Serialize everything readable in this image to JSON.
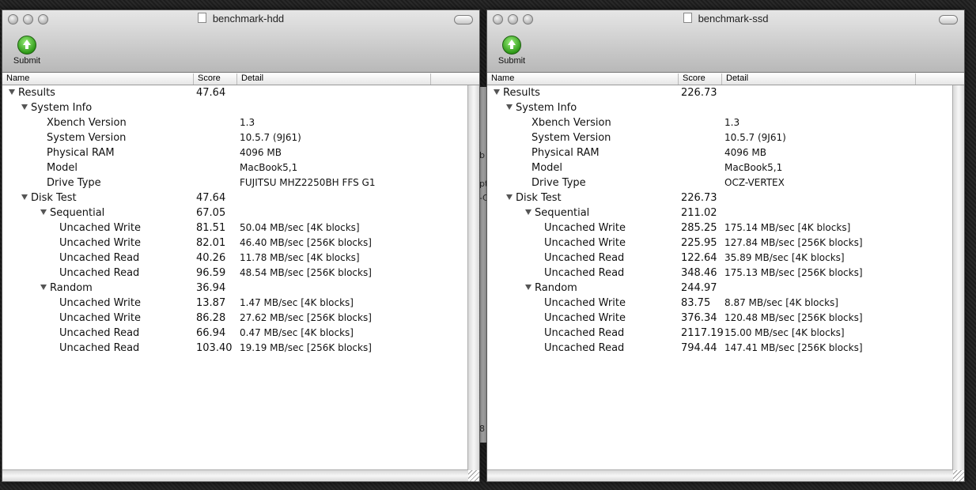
{
  "colors": {
    "background": "#1c1c1c",
    "toolbar_top": "#e6e6e6",
    "toolbar_bottom": "#b8b8b8",
    "submit_green": "#2f9a18"
  },
  "middle_strip": [
    "b",
    "pt",
    "-C",
    "8"
  ],
  "windows": [
    {
      "title": "benchmark-hdd",
      "submit_label": "Submit",
      "columns": {
        "name": "Name",
        "score": "Score",
        "detail": "Detail"
      },
      "rows": [
        {
          "name": "Results",
          "score": "47.64",
          "detail": "",
          "level": 0,
          "expanded": true
        },
        {
          "name": "System Info",
          "score": "",
          "detail": "",
          "level": 1,
          "expanded": true
        },
        {
          "name": "Xbench Version",
          "score": "",
          "detail": "1.3",
          "level": 2
        },
        {
          "name": "System Version",
          "score": "",
          "detail": "10.5.7 (9J61)",
          "level": 2
        },
        {
          "name": "Physical RAM",
          "score": "",
          "detail": "4096 MB",
          "level": 2
        },
        {
          "name": "Model",
          "score": "",
          "detail": "MacBook5,1",
          "level": 2
        },
        {
          "name": "Drive Type",
          "score": "",
          "detail": "FUJITSU MHZ2250BH FFS G1",
          "level": 2
        },
        {
          "name": "Disk Test",
          "score": "47.64",
          "detail": "",
          "level": 1,
          "expanded": true
        },
        {
          "name": "Sequential",
          "score": "67.05",
          "detail": "",
          "level": 2,
          "expanded": true
        },
        {
          "name": "Uncached Write",
          "score": "81.51",
          "detail": "50.04 MB/sec [4K blocks]",
          "level": 3
        },
        {
          "name": "Uncached Write",
          "score": "82.01",
          "detail": "46.40 MB/sec [256K blocks]",
          "level": 3
        },
        {
          "name": "Uncached Read",
          "score": "40.26",
          "detail": "11.78 MB/sec [4K blocks]",
          "level": 3
        },
        {
          "name": "Uncached Read",
          "score": "96.59",
          "detail": "48.54 MB/sec [256K blocks]",
          "level": 3
        },
        {
          "name": "Random",
          "score": "36.94",
          "detail": "",
          "level": 2,
          "expanded": true
        },
        {
          "name": "Uncached Write",
          "score": "13.87",
          "detail": "1.47 MB/sec [4K blocks]",
          "level": 3
        },
        {
          "name": "Uncached Write",
          "score": "86.28",
          "detail": "27.62 MB/sec [256K blocks]",
          "level": 3
        },
        {
          "name": "Uncached Read",
          "score": "66.94",
          "detail": "0.47 MB/sec [4K blocks]",
          "level": 3
        },
        {
          "name": "Uncached Read",
          "score": "103.40",
          "detail": "19.19 MB/sec [256K blocks]",
          "level": 3
        }
      ]
    },
    {
      "title": "benchmark-ssd",
      "submit_label": "Submit",
      "columns": {
        "name": "Name",
        "score": "Score",
        "detail": "Detail"
      },
      "rows": [
        {
          "name": "Results",
          "score": "226.73",
          "detail": "",
          "level": 0,
          "expanded": true
        },
        {
          "name": "System Info",
          "score": "",
          "detail": "",
          "level": 1,
          "expanded": true
        },
        {
          "name": "Xbench Version",
          "score": "",
          "detail": "1.3",
          "level": 2
        },
        {
          "name": "System Version",
          "score": "",
          "detail": "10.5.7 (9J61)",
          "level": 2
        },
        {
          "name": "Physical RAM",
          "score": "",
          "detail": "4096 MB",
          "level": 2
        },
        {
          "name": "Model",
          "score": "",
          "detail": "MacBook5,1",
          "level": 2
        },
        {
          "name": "Drive Type",
          "score": "",
          "detail": "OCZ-VERTEX",
          "level": 2
        },
        {
          "name": "Disk Test",
          "score": "226.73",
          "detail": "",
          "level": 1,
          "expanded": true
        },
        {
          "name": "Sequential",
          "score": "211.02",
          "detail": "",
          "level": 2,
          "expanded": true
        },
        {
          "name": "Uncached Write",
          "score": "285.25",
          "detail": "175.14 MB/sec [4K blocks]",
          "level": 3
        },
        {
          "name": "Uncached Write",
          "score": "225.95",
          "detail": "127.84 MB/sec [256K blocks]",
          "level": 3
        },
        {
          "name": "Uncached Read",
          "score": "122.64",
          "detail": "35.89 MB/sec [4K blocks]",
          "level": 3
        },
        {
          "name": "Uncached Read",
          "score": "348.46",
          "detail": "175.13 MB/sec [256K blocks]",
          "level": 3
        },
        {
          "name": "Random",
          "score": "244.97",
          "detail": "",
          "level": 2,
          "expanded": true
        },
        {
          "name": "Uncached Write",
          "score": "83.75",
          "detail": "8.87 MB/sec [4K blocks]",
          "level": 3
        },
        {
          "name": "Uncached Write",
          "score": "376.34",
          "detail": "120.48 MB/sec [256K blocks]",
          "level": 3
        },
        {
          "name": "Uncached Read",
          "score": "2117.19",
          "detail": "15.00 MB/sec [4K blocks]",
          "level": 3
        },
        {
          "name": "Uncached Read",
          "score": "794.44",
          "detail": "147.41 MB/sec [256K blocks]",
          "level": 3
        }
      ]
    }
  ]
}
